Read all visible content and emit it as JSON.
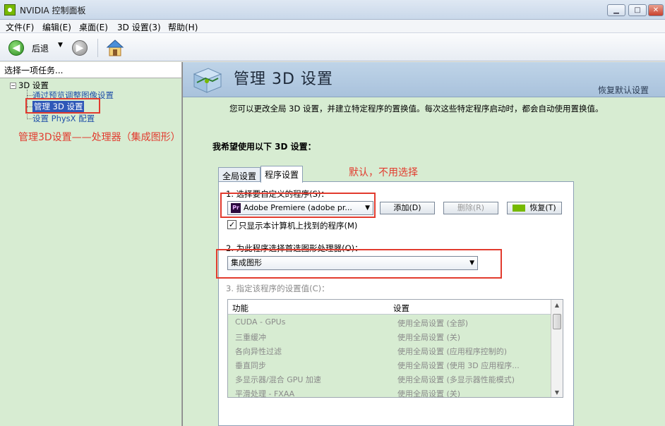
{
  "window": {
    "title": "NVIDIA 控制面板",
    "min": "▁",
    "max": "□",
    "close": "✕"
  },
  "menu": [
    "文件(F)",
    "编辑(E)",
    "桌面(E)",
    "3D 设置(3)",
    "帮助(H)"
  ],
  "toolbar": {
    "back_label": "后退",
    "back_arrow": "◀",
    "fwd_arrow": "▶",
    "dropdown": "▼"
  },
  "left": {
    "header": "选择一项任务...",
    "tree_root": "3D 设置",
    "tree_toggle": "−",
    "items": [
      "通过预览调整图像设置",
      "管理 3D 设置",
      "设置 PhysX 配置"
    ]
  },
  "annotations": {
    "left_note": "管理3D设置——处理器（集成图形）",
    "tab_note": "默认，不用选择"
  },
  "main": {
    "title": "管理 3D 设置",
    "restore_defaults": "恢复默认设置",
    "description": "您可以更改全局 3D 设置，并建立特定程序的置换值。每次这些特定程序启动时，都会自动使用置换值。",
    "section_title": "我希望使用以下 3D 设置：",
    "tabs": [
      "全局设置",
      "程序设置"
    ],
    "step1_label": "1. 选择要自定义的程序(S)：",
    "program_icon": "Pr",
    "program_selected": "Adobe Premiere (adobe pr...",
    "add_button": "添加(D)",
    "remove_button": "删除(R)",
    "restore_button": "恢复(T)",
    "checkbox_label": "只显示本计算机上找到的程序(M)",
    "checkbox_mark": "✓",
    "step2_label": "2. 为此程序选择首选图形处理器(O)：",
    "gpu_selected": "集成图形",
    "step3_label": "3. 指定该程序的设置值(C)：",
    "table_headers": [
      "功能",
      "设置"
    ],
    "rows": [
      [
        "CUDA - GPUs",
        "使用全局设置 (全部)"
      ],
      [
        "三重缓冲",
        "使用全局设置 (关)"
      ],
      [
        "各向异性过滤",
        "使用全局设置 (应用程序控制的)"
      ],
      [
        "垂直同步",
        "使用全局设置 (使用 3D 应用程序..."
      ],
      [
        "多显示器/混合 GPU 加速",
        "使用全局设置 (多显示器性能模式)"
      ],
      [
        "平滑处理 - FXAA",
        "使用全局设置 (关)"
      ]
    ],
    "scroll_up": "▲",
    "scroll_down": "▼"
  }
}
